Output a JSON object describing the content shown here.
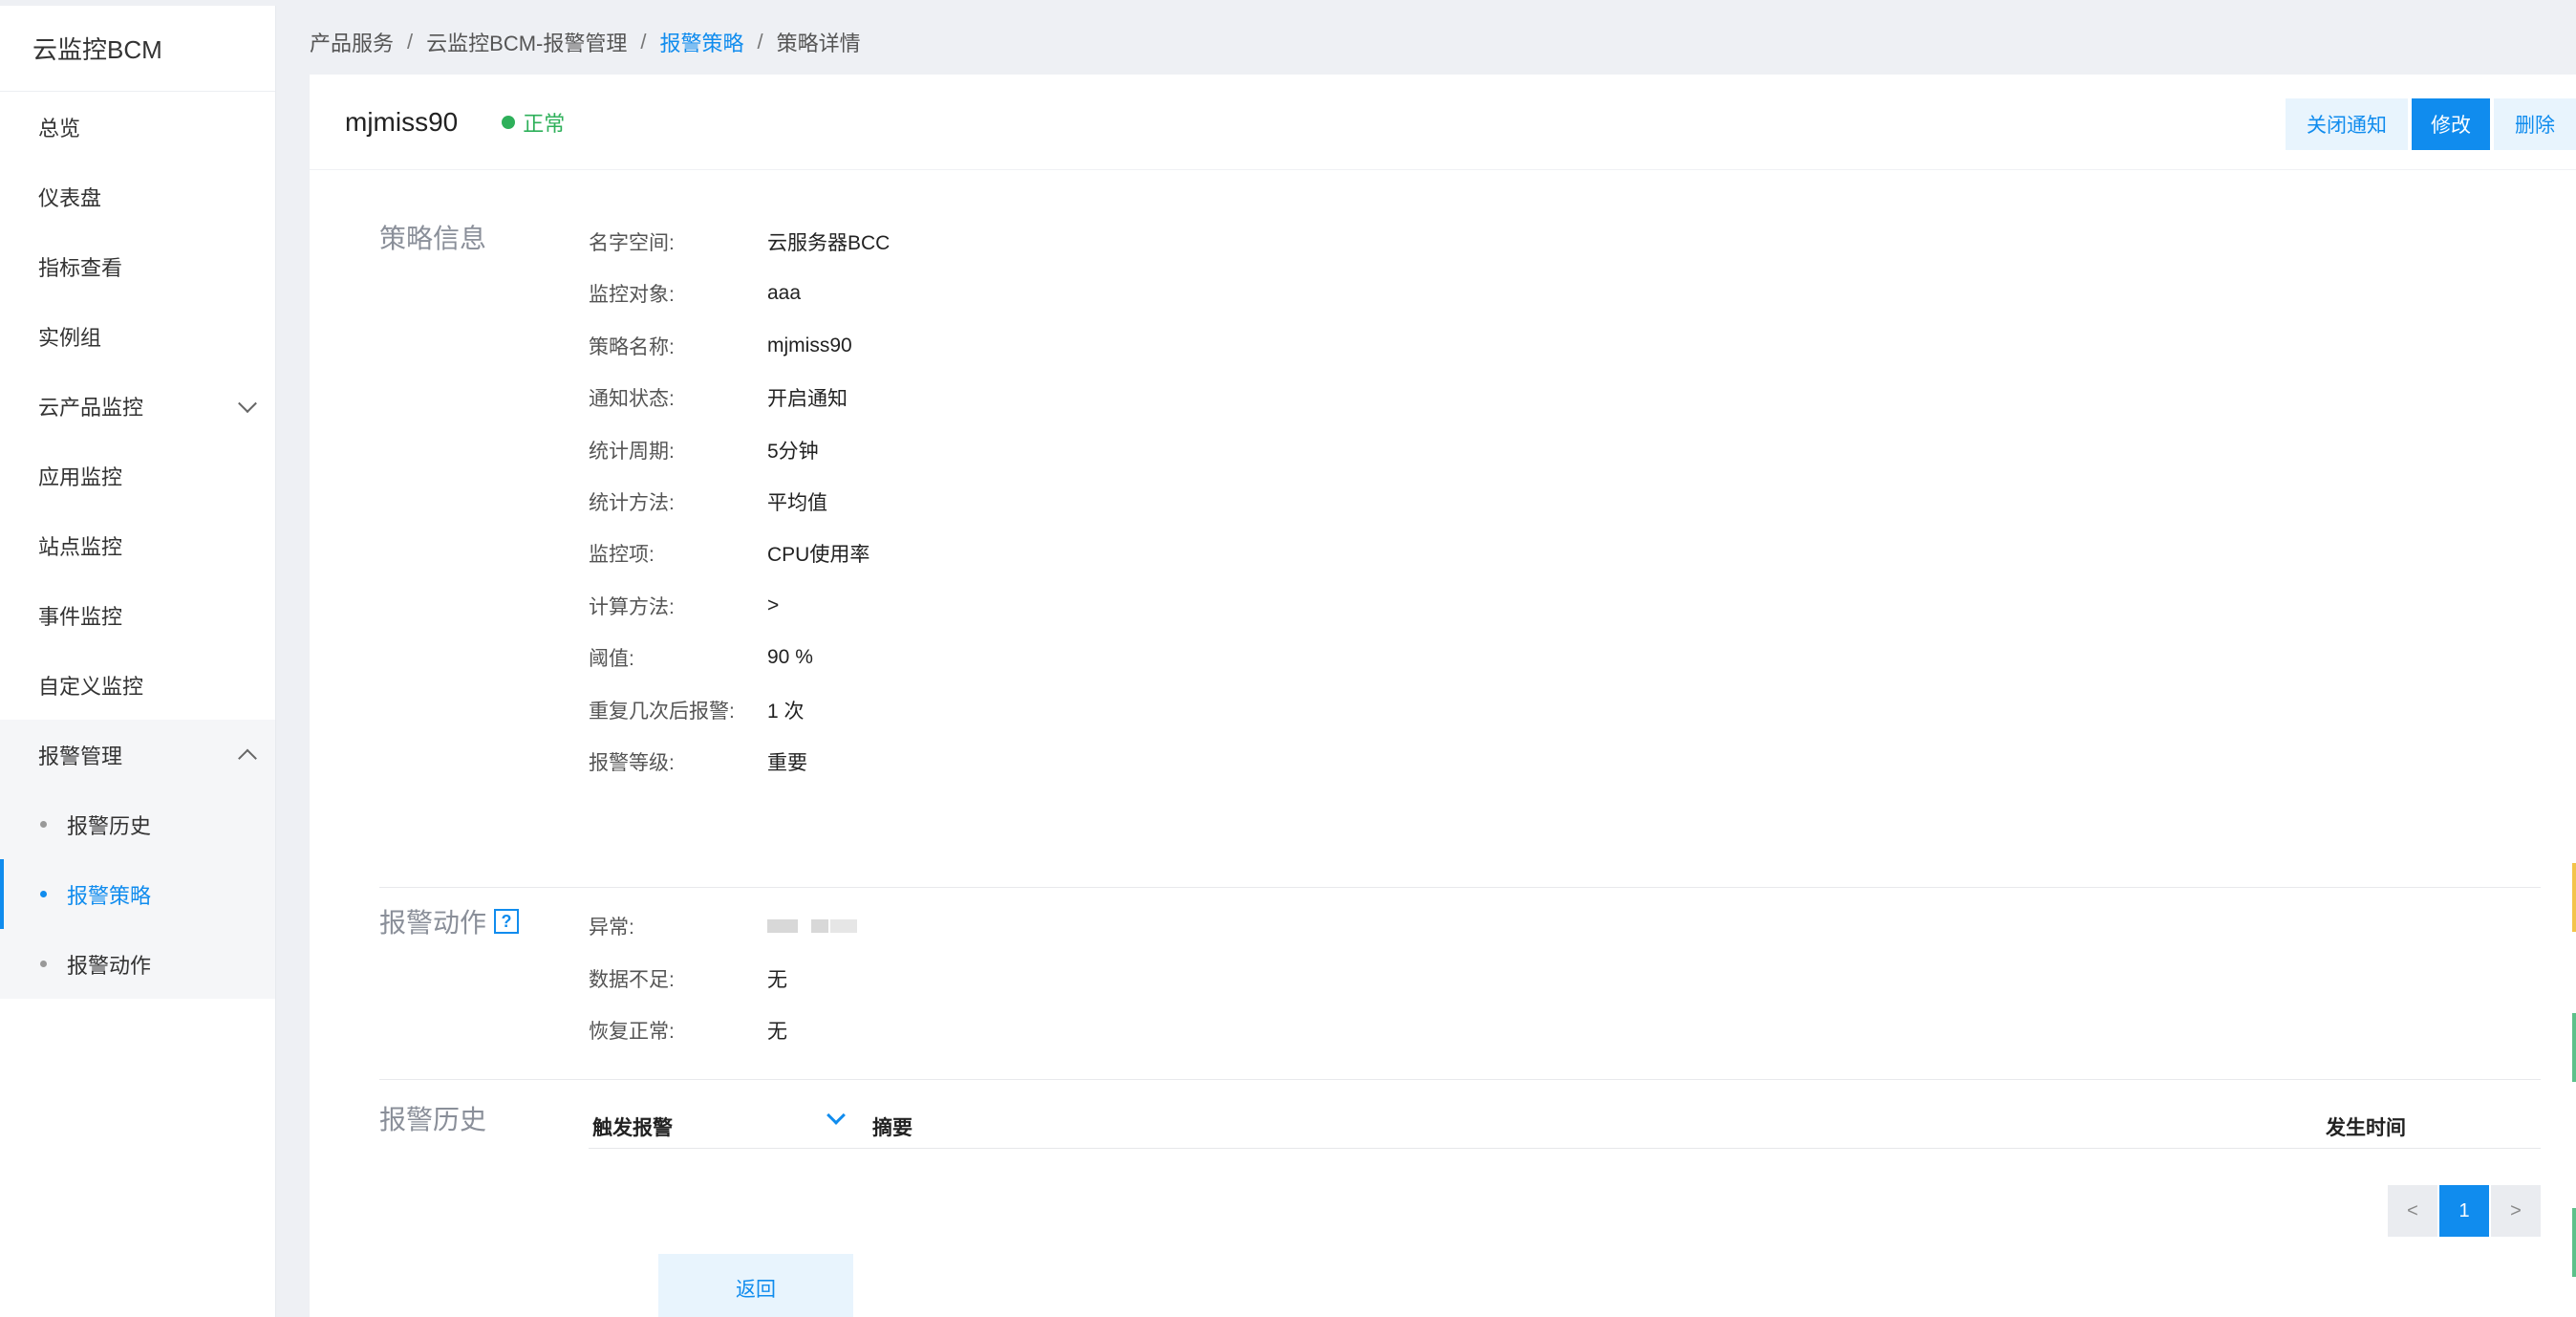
{
  "app": {
    "title": "云监控BCM"
  },
  "sidebar": {
    "items": [
      {
        "label": "总览"
      },
      {
        "label": "仪表盘"
      },
      {
        "label": "指标查看"
      },
      {
        "label": "实例组"
      },
      {
        "label": "云产品监控"
      },
      {
        "label": "应用监控"
      },
      {
        "label": "站点监控"
      },
      {
        "label": "事件监控"
      },
      {
        "label": "自定义监控"
      }
    ],
    "group": {
      "label": "报警管理",
      "children": [
        {
          "label": "报警历史"
        },
        {
          "label": "报警策略"
        },
        {
          "label": "报警动作"
        }
      ]
    }
  },
  "breadcrumb": [
    "产品服务",
    "云监控BCM-报警管理",
    "报警策略",
    "策略详情"
  ],
  "header": {
    "title": "mjmiss90",
    "status": "正常",
    "status_color": "#2eb05a",
    "buttons": {
      "close_notify": "关闭通知",
      "edit": "修改",
      "delete": "删除"
    }
  },
  "policy_info": {
    "section_title": "策略信息",
    "fields": [
      {
        "label": "名字空间:",
        "value": "云服务器BCC"
      },
      {
        "label": "监控对象:",
        "value": "aaa"
      },
      {
        "label": "策略名称:",
        "value": "mjmiss90"
      },
      {
        "label": "通知状态:",
        "value": "开启通知"
      },
      {
        "label": "统计周期:",
        "value": "5分钟"
      },
      {
        "label": "统计方法:",
        "value": "平均值"
      },
      {
        "label": "监控项:",
        "value": "CPU使用率"
      },
      {
        "label": "计算方法:",
        "value": ">"
      },
      {
        "label": "阈值:",
        "value": "90 %"
      },
      {
        "label": "重复几次后报警:",
        "value": "1 次"
      },
      {
        "label": "报警等级:",
        "value": "重要"
      }
    ]
  },
  "alarm_action": {
    "section_title": "报警动作",
    "help_icon": "?",
    "fields": [
      {
        "label": "异常:",
        "value": ""
      },
      {
        "label": "数据不足:",
        "value": "无"
      },
      {
        "label": "恢复正常:",
        "value": "无"
      }
    ]
  },
  "alarm_history": {
    "section_title": "报警历史",
    "columns": [
      "触发报警",
      "摘要",
      "发生时间"
    ],
    "pagination": {
      "prev": "<",
      "current": "1",
      "next": ">"
    }
  },
  "back_button": "返回",
  "accent_color": "#108cee"
}
